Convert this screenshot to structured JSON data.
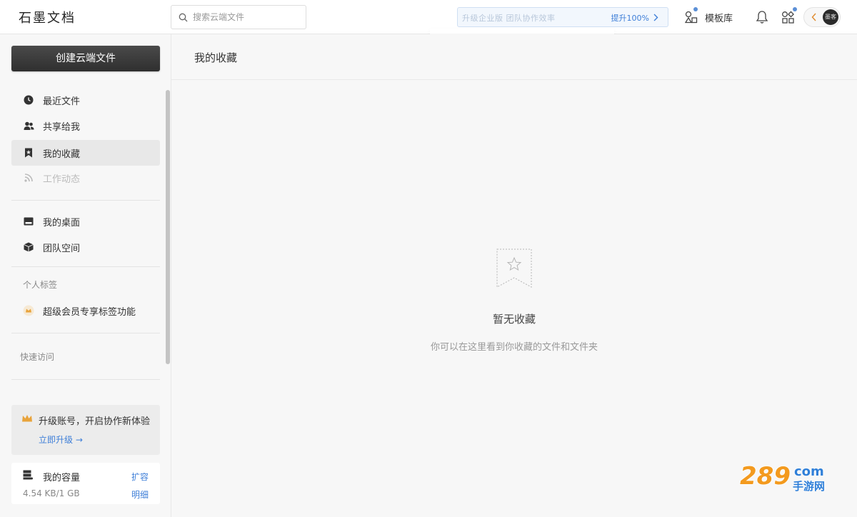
{
  "header": {
    "logo": "石墨文档",
    "search_placeholder": "搜索云端文件",
    "promo_text": "升级企业版 团队协作效率",
    "promo_cta": "提升100%",
    "template_label": "模板库",
    "avatar_text": "墨客"
  },
  "sidebar": {
    "create_button": "创建云端文件",
    "nav_primary": [
      {
        "label": "最近文件",
        "icon": "clock-icon"
      },
      {
        "label": "共享给我",
        "icon": "people-icon"
      },
      {
        "label": "我的收藏",
        "icon": "bookmark-icon",
        "active": true
      },
      {
        "label": "工作动态",
        "icon": "rss-icon",
        "disabled": true
      }
    ],
    "nav_secondary": [
      {
        "label": "我的桌面",
        "icon": "desktop-icon"
      },
      {
        "label": "团队空间",
        "icon": "cube-icon"
      }
    ],
    "tags_section_label": "个人标签",
    "tags_item": "超级会员专享标签功能",
    "quick_access_label": "快速访问",
    "upgrade": {
      "title": "升级账号，开启协作新体验",
      "link": "立即升级 →"
    },
    "storage": {
      "title": "我的容量",
      "expand": "扩容",
      "usage": "4.54 KB/1 GB",
      "detail": "明细"
    }
  },
  "main": {
    "page_title": "我的收藏",
    "empty_title": "暂无收藏",
    "empty_desc": "你可以在这里看到你收藏的文件和文件夹"
  },
  "watermark": {
    "big": "289",
    "com": "com",
    "sub": "手游网"
  },
  "colors": {
    "accent": "#3f7fd8",
    "create_button": "#3a3a3a",
    "crown": "#e8a33b",
    "watermark_orange": "#f39a1e",
    "watermark_blue": "#2f7fd8"
  }
}
